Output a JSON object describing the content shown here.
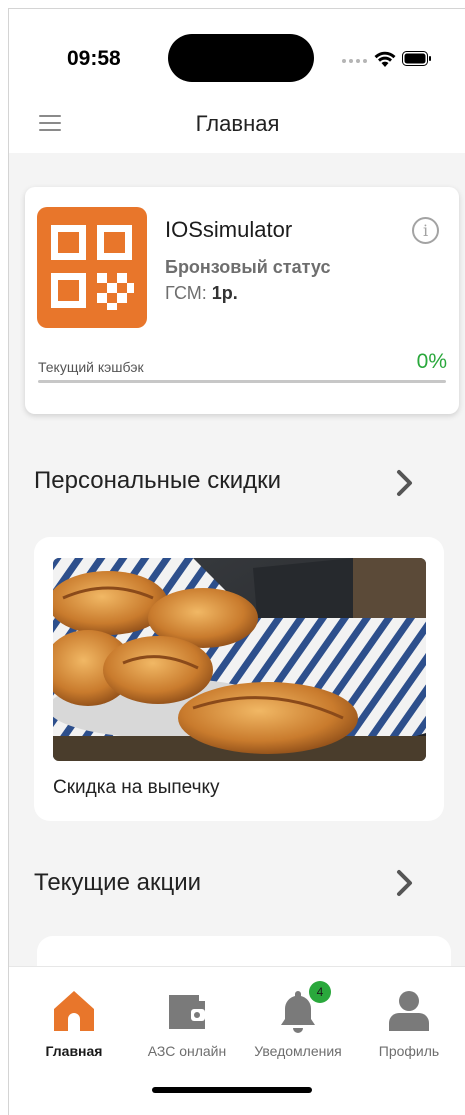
{
  "status_bar": {
    "time": "09:58"
  },
  "header": {
    "title": "Главная"
  },
  "loyalty_card": {
    "user_name": "IOSsimulator",
    "status": "Бронзовый статус",
    "gsm_label": "ГСМ:",
    "gsm_value": "1р.",
    "cashback_label": "Текущий кэшбэк",
    "cashback_value": "0%",
    "cashback_progress": 0,
    "accent_color": "#e8762b",
    "cashback_color": "#2aa83c"
  },
  "personal_discounts": {
    "title": "Персональные скидки",
    "items": [
      {
        "caption": "Скидка на выпечку",
        "image": "croissants-photo"
      }
    ]
  },
  "current_promos": {
    "title": "Текущие акции"
  },
  "tab_bar": {
    "items": [
      {
        "label": "Главная",
        "icon": "home-icon",
        "active": true
      },
      {
        "label": "АЗС онлайн",
        "icon": "wallet-icon",
        "active": false
      },
      {
        "label": "Уведомления",
        "icon": "bell-icon",
        "active": false,
        "badge": "4"
      },
      {
        "label": "Профиль",
        "icon": "user-icon",
        "active": false
      }
    ]
  }
}
